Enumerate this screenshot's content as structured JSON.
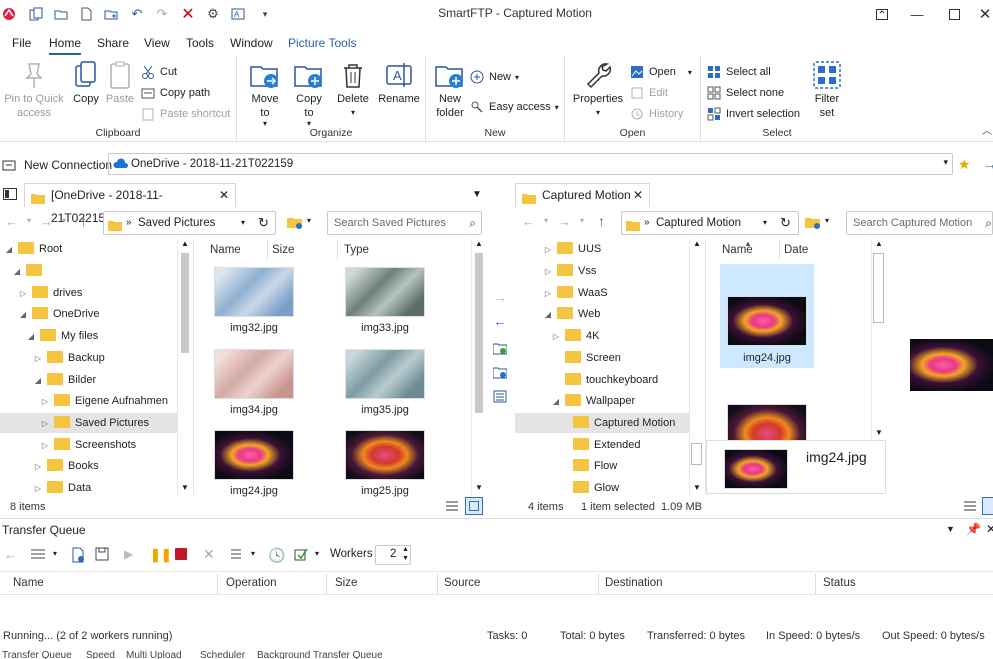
{
  "window": {
    "title": "SmartFTP - Captured Motion"
  },
  "menu": {
    "items": [
      "File",
      "Home",
      "Share",
      "View",
      "Tools",
      "Window",
      "Picture Tools"
    ],
    "active": "Home"
  },
  "ribbon": {
    "clipboard": {
      "label": "Clipboard",
      "pin": "Pin to Quick access",
      "pin1": "Pin to Quick",
      "pin2": "access",
      "copy": "Copy",
      "paste": "Paste",
      "cut": "Cut",
      "copy_path": "Copy path",
      "paste_shortcut": "Paste shortcut"
    },
    "organize": {
      "label": "Organize",
      "move1": "Move",
      "move2": "to",
      "copy1": "Copy",
      "copy2": "to",
      "delete": "Delete",
      "rename": "Rename"
    },
    "new": {
      "label": "New",
      "new_folder1": "New",
      "new_folder2": "folder",
      "new": "New",
      "easy_access": "Easy access"
    },
    "open": {
      "label": "Open",
      "properties": "Properties",
      "open": "Open",
      "edit": "Edit",
      "history": "History"
    },
    "select": {
      "label": "Select",
      "select_all": "Select all",
      "select_none": "Select none",
      "invert": "Invert selection",
      "filter1": "Filter",
      "filter2": "set"
    }
  },
  "address": {
    "new_connection": "New Connection",
    "path": "OneDrive - 2018-11-21T022159"
  },
  "left": {
    "tab": "[OneDrive - 2018-11-21T022159]...",
    "path": "Saved Pictures",
    "search_placeholder": "Search Saved Pictures",
    "tree": [
      {
        "label": "Root"
      },
      {
        "label": ""
      },
      {
        "label": "drives"
      },
      {
        "label": "OneDrive"
      },
      {
        "label": "My files"
      },
      {
        "label": "Backup"
      },
      {
        "label": "Bilder"
      },
      {
        "label": "Eigene Aufnahmen"
      },
      {
        "label": "Saved Pictures"
      },
      {
        "label": "Screenshots"
      },
      {
        "label": "Books"
      },
      {
        "label": "Data"
      }
    ],
    "columns": [
      "Name",
      "Size",
      "Type"
    ],
    "files": [
      {
        "name": "img32.jpg"
      },
      {
        "name": "img33.jpg"
      },
      {
        "name": "img34.jpg"
      },
      {
        "name": "img35.jpg"
      },
      {
        "name": "img24.jpg"
      },
      {
        "name": "img25.jpg"
      }
    ],
    "status": "8 items"
  },
  "right": {
    "tab": "Captured Motion",
    "path": "Captured Motion",
    "search_placeholder": "Search Captured Motion",
    "tree": [
      {
        "label": "UUS"
      },
      {
        "label": "Vss"
      },
      {
        "label": "WaaS"
      },
      {
        "label": "Web"
      },
      {
        "label": "4K"
      },
      {
        "label": "Screen"
      },
      {
        "label": "touchkeyboard"
      },
      {
        "label": "Wallpaper"
      },
      {
        "label": "Captured Motion"
      },
      {
        "label": "Extended"
      },
      {
        "label": "Flow"
      },
      {
        "label": "Glow"
      }
    ],
    "columns": [
      "Name",
      "Date"
    ],
    "selected_file": "img24.jpg",
    "hover_file": "img24.jpg",
    "status_items": "4 items",
    "status_selected": "1 item selected",
    "status_size": "1.09 MB"
  },
  "transfer": {
    "title": "Transfer Queue",
    "workers_label": "Workers",
    "workers_value": "2",
    "columns": [
      "Name",
      "Operation",
      "Size",
      "Source",
      "Destination",
      "Status"
    ],
    "status": {
      "running": "Running... (2 of 2 workers running)",
      "tasks": "Tasks: 0",
      "total": "Total: 0 bytes",
      "transferred": "Transferred: 0 bytes",
      "in_speed": "In Speed: 0 bytes/s",
      "out_speed": "Out Speed: 0 bytes/s"
    },
    "tabs": [
      "Transfer Queue",
      "Speed",
      "Multi Upload",
      "Scheduler",
      "Background Transfer Queue"
    ]
  },
  "colors": {
    "accent": "#2a5fac",
    "folder": "#f5c542",
    "selection": "#cde8ff"
  }
}
